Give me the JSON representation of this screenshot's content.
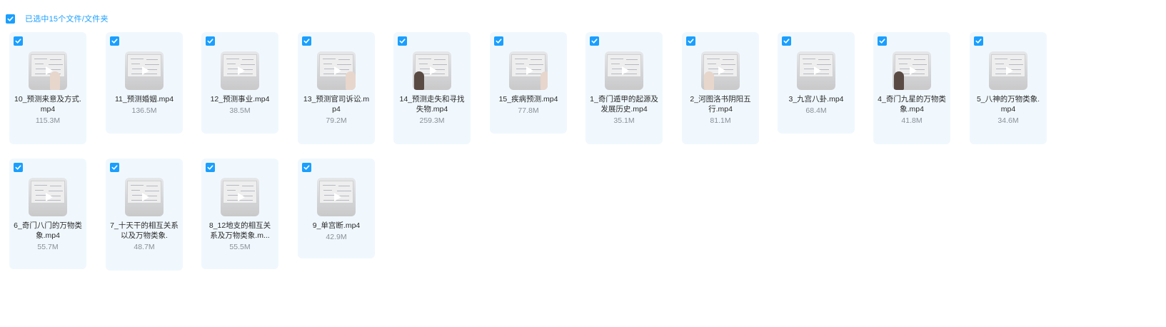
{
  "header": {
    "select_all_checked": true,
    "selection_text": "已选中15个文件/文件夹"
  },
  "colors": {
    "accent": "#1a9fff",
    "card_bg": "#f0f8fe",
    "filename": "#2b2b2b",
    "filesize": "#8a8f96"
  },
  "files": [
    {
      "name": "10_预测来意及方式.mp4",
      "size": "115.3M",
      "checked": true,
      "icon": "video-thumbnail"
    },
    {
      "name": "11_预测婚姻.mp4",
      "size": "136.5M",
      "checked": true,
      "icon": "video-thumbnail"
    },
    {
      "name": "12_预测事业.mp4",
      "size": "38.5M",
      "checked": true,
      "icon": "video-thumbnail"
    },
    {
      "name": "13_预测官司诉讼.mp4",
      "size": "79.2M",
      "checked": true,
      "icon": "video-thumbnail"
    },
    {
      "name": "14_预测走失和寻找失物.mp4",
      "size": "259.3M",
      "checked": true,
      "icon": "video-thumbnail"
    },
    {
      "name": "15_疾病预测.mp4",
      "size": "77.8M",
      "checked": true,
      "icon": "video-thumbnail"
    },
    {
      "name": "1_奇门遁甲的起源及发展历史.mp4",
      "size": "35.1M",
      "checked": true,
      "icon": "video-thumbnail"
    },
    {
      "name": "2_河图洛书阴阳五行.mp4",
      "size": "81.1M",
      "checked": true,
      "icon": "video-thumbnail"
    },
    {
      "name": "3_九宫八卦.mp4",
      "size": "68.4M",
      "checked": true,
      "icon": "video-thumbnail"
    },
    {
      "name": "4_奇门九星的万物类象.mp4",
      "size": "41.8M",
      "checked": true,
      "icon": "video-thumbnail"
    },
    {
      "name": "5_八神的万物类象.mp4",
      "size": "34.6M",
      "checked": true,
      "icon": "video-thumbnail"
    },
    {
      "name": "6_奇门八门的万物类象.mp4",
      "size": "55.7M",
      "checked": true,
      "icon": "video-thumbnail"
    },
    {
      "name": "7_十天干的相互关系以及万物类象.",
      "size": "48.7M",
      "checked": true,
      "icon": "video-thumbnail"
    },
    {
      "name": "8_12地支的相互关系及万物类象.m...",
      "size": "55.5M",
      "checked": true,
      "icon": "video-thumbnail"
    },
    {
      "name": "9_单宫断.mp4",
      "size": "42.9M",
      "checked": true,
      "icon": "video-thumbnail"
    }
  ]
}
